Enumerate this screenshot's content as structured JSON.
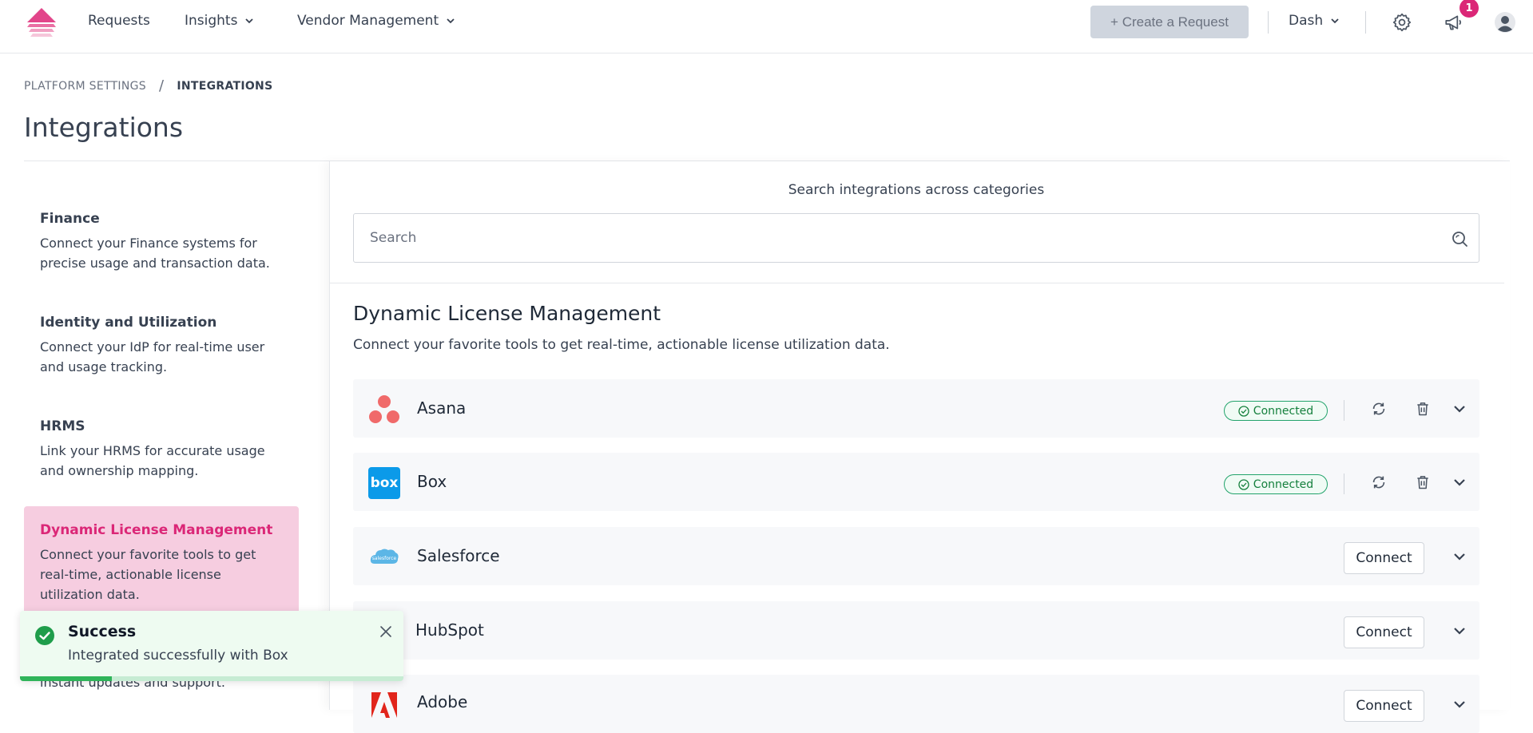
{
  "nav": {
    "items": [
      {
        "label": "Requests",
        "has_dropdown": false
      },
      {
        "label": "Insights",
        "has_dropdown": true
      },
      {
        "label": "Vendor Management",
        "has_dropdown": true
      }
    ],
    "create_request_label": "+ Create a Request",
    "user_menu_label": "Dash",
    "notification_count": "1",
    "icons": [
      "logo-icon",
      "gear-icon",
      "megaphone-icon",
      "user-avatar-icon",
      "chevron-down-icon"
    ]
  },
  "breadcrumb": {
    "parent": "PLATFORM SETTINGS",
    "separator": "/",
    "current": "INTEGRATIONS"
  },
  "page_title": "Integrations",
  "sidebar": {
    "categories": [
      {
        "title": "Finance",
        "description": "Connect your Finance systems for precise usage and transaction data.",
        "active": false
      },
      {
        "title": "Identity and Utilization",
        "description": "Connect your IdP for real-time user and usage tracking.",
        "active": false
      },
      {
        "title": "HRMS",
        "description": "Link your HRMS for accurate usage and ownership mapping.",
        "active": false
      },
      {
        "title": "Dynamic License Management",
        "description": "Connect your favorite tools to get real-time, actionable license utilization data.",
        "active": true
      }
    ],
    "partially_hidden_text": "instant updates and support."
  },
  "search": {
    "caption": "Search integrations across categories",
    "placeholder": "Search",
    "value": ""
  },
  "section": {
    "title": "Dynamic License Management",
    "subtitle": "Connect your favorite tools to get real-time, actionable license utilization data."
  },
  "integrations": [
    {
      "name": "Asana",
      "status": "Connected",
      "connected": true,
      "logo": "asana-logo"
    },
    {
      "name": "Box",
      "status": "Connected",
      "connected": true,
      "logo": "box-logo",
      "logo_text": "box"
    },
    {
      "name": "Salesforce",
      "connected": false,
      "button": "Connect",
      "logo": "salesforce-logo",
      "logo_text": "salesforce"
    },
    {
      "name": "HubSpot",
      "connected": false,
      "button": "Connect",
      "logo": "hubspot-logo"
    },
    {
      "name": "Adobe",
      "connected": false,
      "button": "Connect",
      "logo": "adobe-logo"
    }
  ],
  "toast": {
    "title": "Success",
    "message": "Integrated successfully with Box",
    "progress": 0.24
  },
  "colors": {
    "brand_pink": "#db2777",
    "active_bg": "#f6cde0",
    "connected_green": "#22a36b",
    "create_button_bg": "#cfd5de"
  }
}
